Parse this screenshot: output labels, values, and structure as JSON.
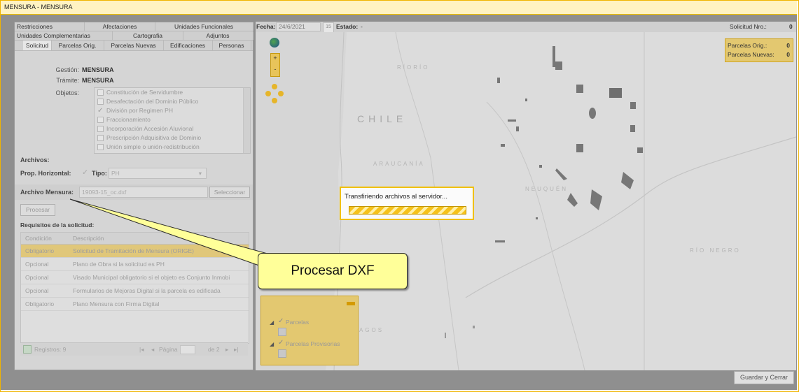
{
  "window": {
    "title": "MENSURA - MENSURA"
  },
  "tabs_row1": [
    "Restricciones",
    "Afectaciones",
    "Unidades Funcionales"
  ],
  "tabs_row2": [
    "Unidades Complementarias",
    "Cartografia",
    "Adjuntos"
  ],
  "tabs_row3": [
    "Solicitud",
    "Parcelas Orig.",
    "Parcelas Nuevas",
    "Edificaciones",
    "Personas"
  ],
  "form": {
    "gestion_label": "Gestión:",
    "gestion_value": "MENSURA",
    "tramite_label": "Trámite:",
    "tramite_value": "MENSURA",
    "objetos_label": "Objetos:",
    "objetos": [
      {
        "label": "Constitución de Servidumbre",
        "checked": false
      },
      {
        "label": "Desafectación del Dominio Público",
        "checked": false
      },
      {
        "label": "División por Regimen PH",
        "checked": true
      },
      {
        "label": "Fraccionamiento",
        "checked": false
      },
      {
        "label": "Incorporación Accesión Aluvional",
        "checked": false
      },
      {
        "label": "Prescripción Adquisitiva de Dominio",
        "checked": false
      },
      {
        "label": "Unión simple o unión-redistribución",
        "checked": false
      }
    ],
    "archivos_title": "Archivos:",
    "prop_horizontal_label": "Prop. Horizontal:",
    "tipo_label": "Tipo:",
    "tipo_value": "PH",
    "archivo_mensura_label": "Archivo Mensura:",
    "archivo_mensura_value": "19093-15_oc.dxf",
    "seleccionar_label": "Seleccionar",
    "procesar_label": "Procesar",
    "requisitos_title": "Requisitos de la solicitud:"
  },
  "requisitos": {
    "headers": [
      "Condición",
      "Descripción"
    ],
    "rows": [
      {
        "condicion": "Obligatorio",
        "descripcion": "Solicitud de Tramitación de Mensura (ORIGE)",
        "highlight": true
      },
      {
        "condicion": "Opcional",
        "descripcion": "Plano de Obra si la solicitud es PH",
        "highlight": false
      },
      {
        "condicion": "Opcional",
        "descripcion": "Visado Municipal obligatorio si el objeto es Conjunto Inmobi",
        "highlight": false
      },
      {
        "condicion": "Opcional",
        "descripcion": "Formularios de Mejoras Digital si la parcela es edificada",
        "highlight": false
      },
      {
        "condicion": "Obligatorio",
        "descripcion": "Plano Mensura con Firma Digital",
        "highlight": false
      }
    ],
    "pager": {
      "registros": "Registros: 9",
      "pagina_label": "Página",
      "de": "de 2"
    }
  },
  "header_info": {
    "fecha_label": "Fecha:",
    "fecha_value": "24/6/2021",
    "cal_day": "15",
    "estado_label": "Estado:",
    "estado_value": "-",
    "solicitud_label": "Solicitud Nro.:",
    "solicitud_value": "0"
  },
  "parcel_counter": {
    "orig_label": "Parcelas Orig.:",
    "orig_value": "0",
    "nuevas_label": "Parcelas Nuevas:",
    "nuevas_value": "0"
  },
  "map_labels": {
    "chile": "CHILE",
    "riorio": "RÍORÍO",
    "araucania": "ARAUCANÍA",
    "neuquen": "NEUQUÉN",
    "rionegro": "RÍO NEGRO",
    "lagos": "AGOS"
  },
  "dialog": {
    "message": "Transfiriendo archivos al servidor..."
  },
  "callout": {
    "text": "Procesar DXF"
  },
  "legend": {
    "items": [
      "Parcelas",
      "Parcelas Provisorias"
    ]
  },
  "footer": {
    "guardar_label": "Guardar y Cerrar"
  },
  "colors": {
    "accent": "#f0c000",
    "highlight": "#e0c77a",
    "callout": "#ffff99"
  }
}
